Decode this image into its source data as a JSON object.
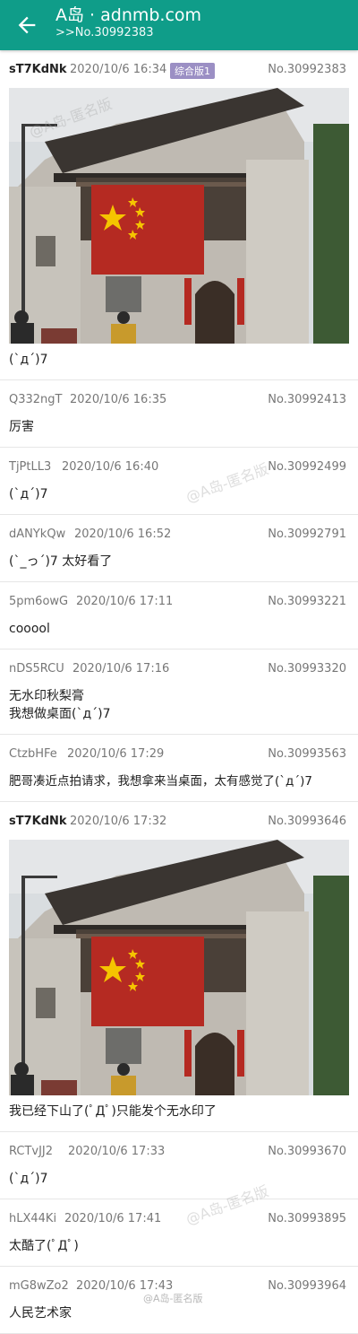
{
  "appbar": {
    "title": "A岛 · adnmb.com",
    "subtitle": ">>No.30992383"
  },
  "colors": {
    "primary": "#0f9d89",
    "tag": "#9b8fc4"
  },
  "watermark": "@A岛-匿名版",
  "posts": [
    {
      "uid": "sT7KdNk",
      "time": "2020/10/6 16:34",
      "tag": "综合版1",
      "no": "No.30992383",
      "body": "(`д´)7",
      "image": true
    },
    {
      "uid": "Q332ngT",
      "time": "2020/10/6 16:35",
      "no": "No.30992413",
      "body": "厉害"
    },
    {
      "uid": "TjPtLL3",
      "time": "2020/10/6 16:40",
      "no": "No.30992499",
      "body": "(`д´)7"
    },
    {
      "uid": "dANYkQw",
      "time": "2020/10/6 16:52",
      "no": "No.30992791",
      "body": "(`_っ´)7 太好看了"
    },
    {
      "uid": "5pm6owG",
      "time": "2020/10/6 17:11",
      "no": "No.30993221",
      "body": "cooool"
    },
    {
      "uid": "nDS5RCU",
      "time": "2020/10/6 17:16",
      "no": "No.30993320",
      "body": "无水印秋梨膏\n我想做桌面(`д´)7"
    },
    {
      "uid": "CtzbHFe",
      "time": "2020/10/6 17:29",
      "no": "No.30993563",
      "body": "肥哥凑近点拍请求，我想拿来当桌面，太有感觉了(`д´)7"
    },
    {
      "uid": "sT7KdNk",
      "time": "2020/10/6 17:32",
      "no": "No.30993646",
      "body": "我已经下山了(ﾟДﾟ)只能发个无水印了",
      "image": true
    },
    {
      "uid": "RCTvJJ2",
      "time": "2020/10/6 17:33",
      "no": "No.30993670",
      "body": "(`д´)7"
    },
    {
      "uid": "hLX44Ki",
      "time": "2020/10/6 17:41",
      "no": "No.30993895",
      "body": "太酷了(ﾟДﾟ)"
    },
    {
      "uid": "mG8wZo2",
      "time": "2020/10/6 17:43",
      "no": "No.30993964",
      "body": "人民艺术家"
    }
  ]
}
